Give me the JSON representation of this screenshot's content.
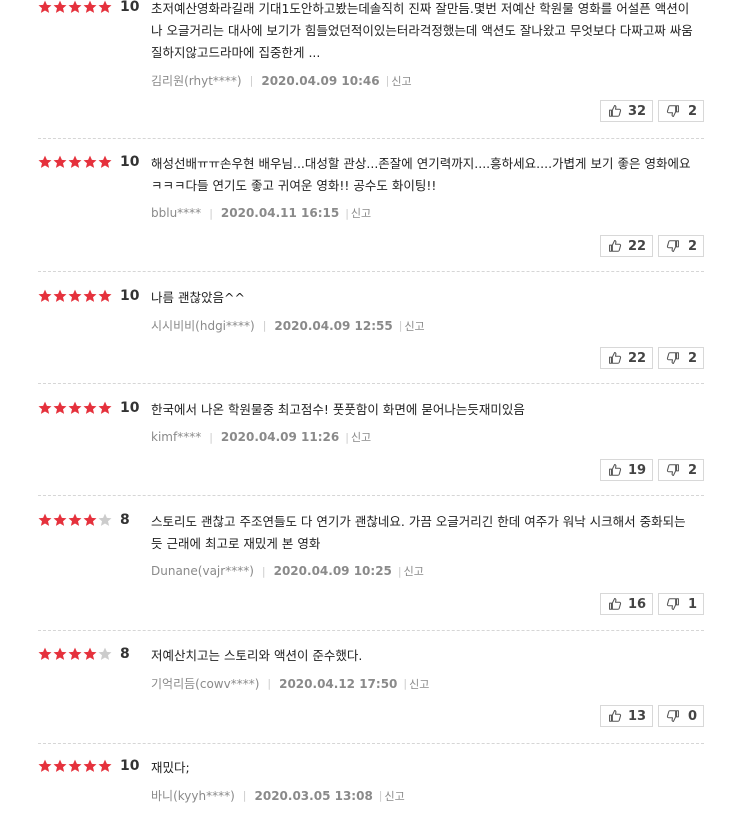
{
  "reviews": [
    {
      "stars_filled": 5,
      "score": "10",
      "text": "초저예산영화라길래 기대1도안하고봤는데솔직히 진짜 잘만듬.몇번 저예산 학원물 영화를 어설픈 액션이나 오글거리는 대사에 보기가 힘들었던적이있는터라걱정했는데 액션도 잘나왔고 무엇보다 다짜고짜 싸움질하지않고드라마에 집중한게 ...",
      "author": "김리원(rhyt****)",
      "date": "2020.04.09 10:46",
      "report": "신고",
      "up": "32",
      "down": "2"
    },
    {
      "stars_filled": 5,
      "score": "10",
      "text": "해성선배ㅠㅠ손우현 배우님...대성할 관상...존잘에 연기력까지....흥하세요....가볍게 보기 좋은 영화에요ㅋㅋㅋ다들 연기도 좋고 귀여운 영화!! 공수도 화이팅!!",
      "author": "bblu****",
      "date": "2020.04.11 16:15",
      "report": "신고",
      "up": "22",
      "down": "2"
    },
    {
      "stars_filled": 5,
      "score": "10",
      "text": "나름 괜찮았음^^",
      "author": "시시비비(hdgi****)",
      "date": "2020.04.09 12:55",
      "report": "신고",
      "up": "22",
      "down": "2"
    },
    {
      "stars_filled": 5,
      "score": "10",
      "text": "한국에서 나온 학원물중 최고점수! 풋풋함이 화면에 묻어나는듯재미있음",
      "author": "kimf****",
      "date": "2020.04.09 11:26",
      "report": "신고",
      "up": "19",
      "down": "2"
    },
    {
      "stars_filled": 4,
      "score": "8",
      "text": "스토리도 괜찮고 주조연들도 다 연기가 괜찮네요. 가끔 오글거리긴 한데 여주가 워낙 시크해서 중화되는 듯 근래에 최고로 재밌게 본 영화",
      "author": "Dunane(vajr****)",
      "date": "2020.04.09 10:25",
      "report": "신고",
      "up": "16",
      "down": "1"
    },
    {
      "stars_filled": 4,
      "score": "8",
      "text": "저예산치고는 스토리와 액션이 준수했다.",
      "author": "기억리듬(cowv****)",
      "date": "2020.04.12 17:50",
      "report": "신고",
      "up": "13",
      "down": "0"
    },
    {
      "stars_filled": 5,
      "score": "10",
      "text": "재밌다;",
      "author": "바니(kyyh****)",
      "date": "2020.03.05 13:08",
      "report": "신고",
      "up": "",
      "down": ""
    }
  ],
  "icons": {
    "star": "star-icon",
    "thumb_up": "thumbs-up-icon",
    "thumb_down": "thumbs-down-icon"
  },
  "colors": {
    "star_filled": "#e5313c",
    "star_empty": "#cccccc"
  }
}
